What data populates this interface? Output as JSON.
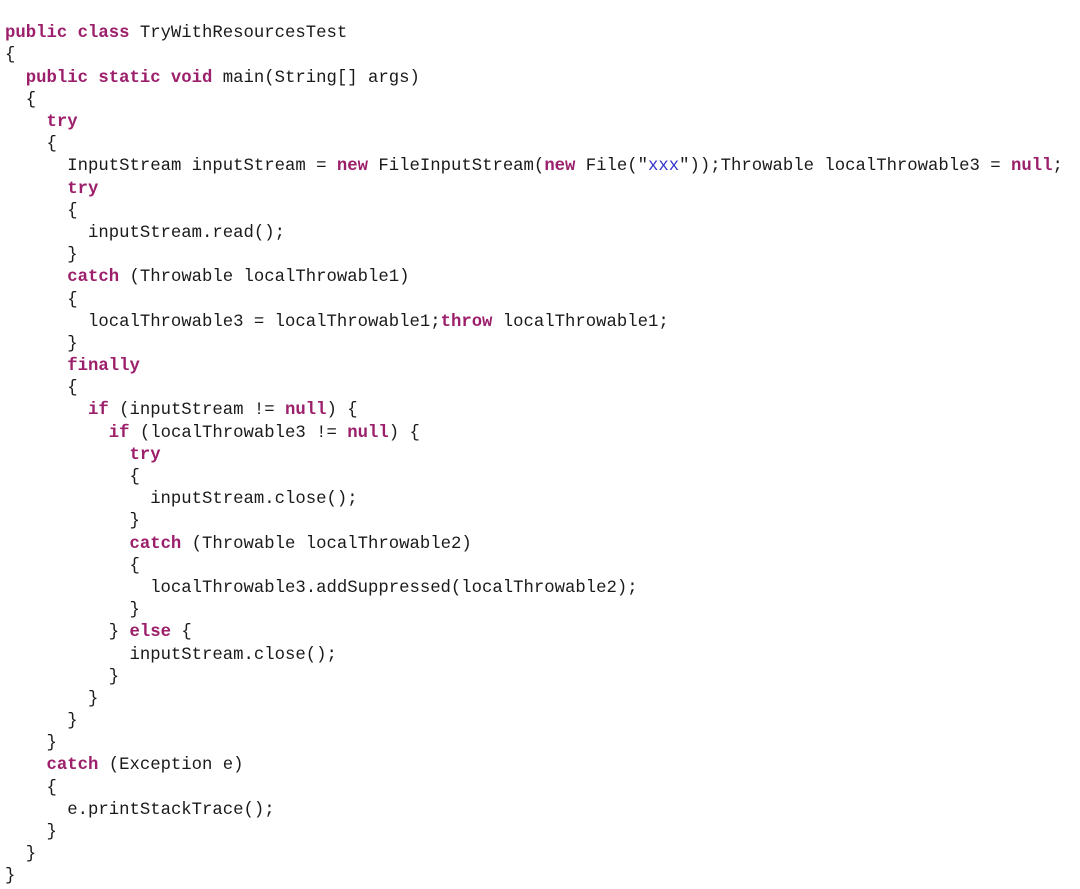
{
  "document": {
    "kind": "source-code-listing",
    "language": "Java",
    "class_name": "TryWithResourcesTest",
    "background_color": "#ffffff",
    "colors": {
      "plain_text": "#1a1a1a",
      "keyword": "#9c1f6b",
      "string_literal": "#3333cc"
    },
    "indent_unit_spaces": 2,
    "line_count": 39
  },
  "code": {
    "lines": [
      {
        "indent": 0,
        "tokens": [
          {
            "t": "kw",
            "v": "public class"
          },
          {
            "t": "pl",
            "v": " TryWithResourcesTest"
          }
        ]
      },
      {
        "indent": 0,
        "tokens": [
          {
            "t": "pl",
            "v": "{"
          }
        ]
      },
      {
        "indent": 1,
        "tokens": [
          {
            "t": "kw",
            "v": "public static void"
          },
          {
            "t": "pl",
            "v": " main(String[] args)"
          }
        ]
      },
      {
        "indent": 1,
        "tokens": [
          {
            "t": "pl",
            "v": "{"
          }
        ]
      },
      {
        "indent": 2,
        "tokens": [
          {
            "t": "kw",
            "v": "try"
          }
        ]
      },
      {
        "indent": 2,
        "tokens": [
          {
            "t": "pl",
            "v": "{"
          }
        ]
      },
      {
        "indent": 3,
        "tokens": [
          {
            "t": "pl",
            "v": "InputStream inputStream = "
          },
          {
            "t": "kw",
            "v": "new"
          },
          {
            "t": "pl",
            "v": " FileInputStream("
          },
          {
            "t": "kw",
            "v": "new"
          },
          {
            "t": "pl",
            "v": " File(\""
          },
          {
            "t": "str",
            "v": "xxx"
          },
          {
            "t": "pl",
            "v": "\"));Throwable localThrowable3 = "
          },
          {
            "t": "kw",
            "v": "null"
          },
          {
            "t": "pl",
            "v": ";"
          }
        ]
      },
      {
        "indent": 3,
        "tokens": [
          {
            "t": "kw",
            "v": "try"
          }
        ]
      },
      {
        "indent": 3,
        "tokens": [
          {
            "t": "pl",
            "v": "{"
          }
        ]
      },
      {
        "indent": 4,
        "tokens": [
          {
            "t": "pl",
            "v": "inputStream.read();"
          }
        ]
      },
      {
        "indent": 3,
        "tokens": [
          {
            "t": "pl",
            "v": "}"
          }
        ]
      },
      {
        "indent": 3,
        "tokens": [
          {
            "t": "kw",
            "v": "catch"
          },
          {
            "t": "pl",
            "v": " (Throwable localThrowable1)"
          }
        ]
      },
      {
        "indent": 3,
        "tokens": [
          {
            "t": "pl",
            "v": "{"
          }
        ]
      },
      {
        "indent": 4,
        "tokens": [
          {
            "t": "pl",
            "v": "localThrowable3 = localThrowable1;"
          },
          {
            "t": "kw",
            "v": "throw"
          },
          {
            "t": "pl",
            "v": " localThrowable1;"
          }
        ]
      },
      {
        "indent": 3,
        "tokens": [
          {
            "t": "pl",
            "v": "}"
          }
        ]
      },
      {
        "indent": 3,
        "tokens": [
          {
            "t": "kw",
            "v": "finally"
          }
        ]
      },
      {
        "indent": 3,
        "tokens": [
          {
            "t": "pl",
            "v": "{"
          }
        ]
      },
      {
        "indent": 4,
        "tokens": [
          {
            "t": "kw",
            "v": "if"
          },
          {
            "t": "pl",
            "v": " (inputStream != "
          },
          {
            "t": "kw",
            "v": "null"
          },
          {
            "t": "pl",
            "v": ") {"
          }
        ]
      },
      {
        "indent": 5,
        "tokens": [
          {
            "t": "kw",
            "v": "if"
          },
          {
            "t": "pl",
            "v": " (localThrowable3 != "
          },
          {
            "t": "kw",
            "v": "null"
          },
          {
            "t": "pl",
            "v": ") {"
          }
        ]
      },
      {
        "indent": 6,
        "tokens": [
          {
            "t": "kw",
            "v": "try"
          }
        ]
      },
      {
        "indent": 6,
        "tokens": [
          {
            "t": "pl",
            "v": "{"
          }
        ]
      },
      {
        "indent": 7,
        "tokens": [
          {
            "t": "pl",
            "v": "inputStream.close();"
          }
        ]
      },
      {
        "indent": 6,
        "tokens": [
          {
            "t": "pl",
            "v": "}"
          }
        ]
      },
      {
        "indent": 6,
        "tokens": [
          {
            "t": "kw",
            "v": "catch"
          },
          {
            "t": "pl",
            "v": " (Throwable localThrowable2)"
          }
        ]
      },
      {
        "indent": 6,
        "tokens": [
          {
            "t": "pl",
            "v": "{"
          }
        ]
      },
      {
        "indent": 7,
        "tokens": [
          {
            "t": "pl",
            "v": "localThrowable3.addSuppressed(localThrowable2);"
          }
        ]
      },
      {
        "indent": 6,
        "tokens": [
          {
            "t": "pl",
            "v": "}"
          }
        ]
      },
      {
        "indent": 5,
        "tokens": [
          {
            "t": "pl",
            "v": "} "
          },
          {
            "t": "kw",
            "v": "else"
          },
          {
            "t": "pl",
            "v": " {"
          }
        ]
      },
      {
        "indent": 6,
        "tokens": [
          {
            "t": "pl",
            "v": "inputStream.close();"
          }
        ]
      },
      {
        "indent": 5,
        "tokens": [
          {
            "t": "pl",
            "v": "}"
          }
        ]
      },
      {
        "indent": 4,
        "tokens": [
          {
            "t": "pl",
            "v": "}"
          }
        ]
      },
      {
        "indent": 3,
        "tokens": [
          {
            "t": "pl",
            "v": "}"
          }
        ]
      },
      {
        "indent": 2,
        "tokens": [
          {
            "t": "pl",
            "v": "}"
          }
        ]
      },
      {
        "indent": 2,
        "tokens": [
          {
            "t": "kw",
            "v": "catch"
          },
          {
            "t": "pl",
            "v": " (Exception e)"
          }
        ]
      },
      {
        "indent": 2,
        "tokens": [
          {
            "t": "pl",
            "v": "{"
          }
        ]
      },
      {
        "indent": 3,
        "tokens": [
          {
            "t": "pl",
            "v": "e.printStackTrace();"
          }
        ]
      },
      {
        "indent": 2,
        "tokens": [
          {
            "t": "pl",
            "v": "}"
          }
        ]
      },
      {
        "indent": 1,
        "tokens": [
          {
            "t": "pl",
            "v": "}"
          }
        ]
      },
      {
        "indent": 0,
        "tokens": [
          {
            "t": "pl",
            "v": "}"
          }
        ]
      }
    ]
  }
}
